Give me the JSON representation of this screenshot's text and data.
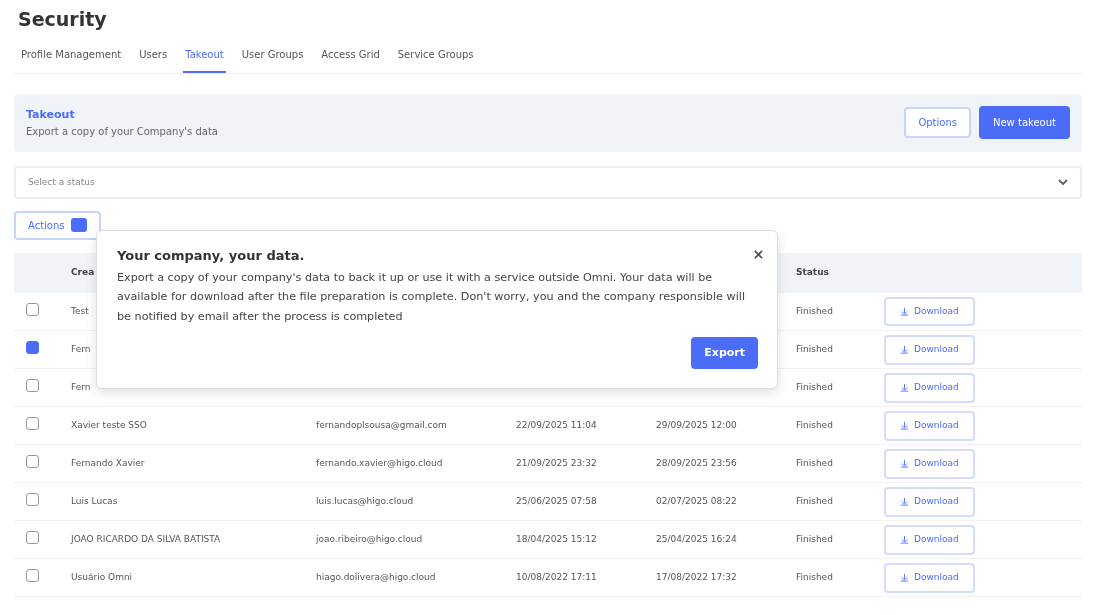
{
  "page": {
    "title": "Security"
  },
  "tabs": [
    {
      "label": "Profile Management",
      "selected": false
    },
    {
      "label": "Users",
      "selected": false
    },
    {
      "label": "Takeout",
      "selected": true
    },
    {
      "label": "User Groups",
      "selected": false
    },
    {
      "label": "Access Grid",
      "selected": false
    },
    {
      "label": "Service Groups",
      "selected": false
    }
  ],
  "banner": {
    "title": "Takeout",
    "subtitle": "Export a copy of your Company's data",
    "buttons": [
      {
        "label": "Options",
        "kind": "outline"
      },
      {
        "label": "New takeout",
        "kind": "primary"
      }
    ]
  },
  "status_filter": {
    "placeholder": "Select a status"
  },
  "actions_button": {
    "label": "Actions"
  },
  "table": {
    "columns": [
      "Crea",
      "Status"
    ],
    "rows": [
      {
        "checked": false,
        "name": "Test",
        "status": "Finished",
        "action": "Download"
      },
      {
        "checked": true,
        "name": "Fern",
        "status": "Finished",
        "action": "Download"
      },
      {
        "checked": false,
        "name": "Fern",
        "status": "Finished",
        "action": "Download"
      },
      {
        "checked": false,
        "name": "Xavier teste SSO",
        "email": "fernandoplsousa@gmail.com",
        "created": "22/09/2025 11:04",
        "expires": "29/09/2025 12:00",
        "status": "Finished",
        "action": "Download"
      },
      {
        "checked": false,
        "name": "Fernando Xavier",
        "email": "fernando.xavier@higo.cloud",
        "created": "21/09/2025 23:32",
        "expires": "28/09/2025 23:56",
        "status": "Finished",
        "action": "Download"
      },
      {
        "checked": false,
        "name": "Luis Lucas",
        "email": "luis.lucas@higo.cloud",
        "created": "25/06/2025 07:58",
        "expires": "02/07/2025 08:22",
        "status": "Finished",
        "action": "Download"
      },
      {
        "checked": false,
        "name": "JOAO RICARDO DA SILVA BATISTA",
        "email": "joao.ribeiro@higo.cloud",
        "created": "18/04/2025 15:12",
        "expires": "25/04/2025 16:24",
        "status": "Finished",
        "action": "Download"
      },
      {
        "checked": false,
        "name": "Usuário Omni",
        "email": "hiago.dolivera@higo.cloud",
        "created": "10/08/2022 17:11",
        "expires": "17/08/2022 17:32",
        "status": "Finished",
        "action": "Download"
      }
    ]
  },
  "popover": {
    "title": "Your company, your data.",
    "body": "Export a copy of your company's data to back it up or use it with a service outside Omni. Your data will be available for download after the file preparation is complete. Don't worry, you and the company responsible will be notified by email after the process is completed",
    "button": "Export"
  }
}
